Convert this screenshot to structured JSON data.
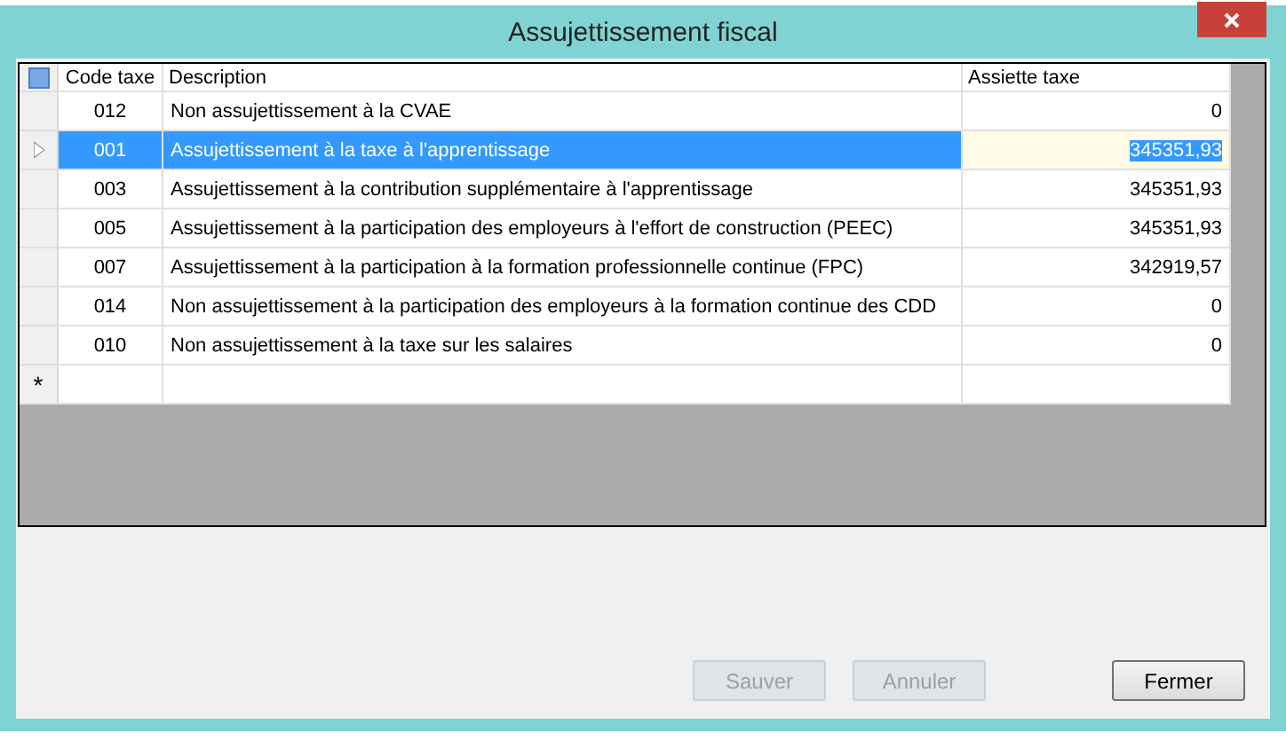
{
  "window": {
    "title": "Assujettissement fiscal"
  },
  "table": {
    "columns": [
      "Code taxe",
      "Description",
      "Assiette taxe"
    ],
    "rows": [
      {
        "code": "012",
        "description": "Non assujettissement à la CVAE",
        "assiette": "0",
        "selected": false
      },
      {
        "code": "001",
        "description": "Assujettissement à la taxe à l'apprentissage",
        "assiette": "345351,93",
        "selected": true
      },
      {
        "code": "003",
        "description": "Assujettissement à la contribution supplémentaire à l'apprentissage",
        "assiette": "345351,93",
        "selected": false
      },
      {
        "code": "005",
        "description": "Assujettissement à la participation des employeurs à l'effort de construction (PEEC)",
        "assiette": "345351,93",
        "selected": false
      },
      {
        "code": "007",
        "description": "Assujettissement à la participation à la formation professionnelle continue (FPC)",
        "assiette": "342919,57",
        "selected": false
      },
      {
        "code": "014",
        "description": "Non assujettissement à la participation des employeurs à la formation continue des CDD",
        "assiette": "0",
        "selected": false
      },
      {
        "code": "010",
        "description": "Non assujettissement à la taxe sur les salaires",
        "assiette": "0",
        "selected": false
      }
    ],
    "new_row_marker": "*"
  },
  "buttons": [
    {
      "label": "Sauver",
      "disabled": true
    },
    {
      "label": "Annuler",
      "disabled": true
    },
    {
      "label": "Fermer",
      "disabled": false
    }
  ]
}
